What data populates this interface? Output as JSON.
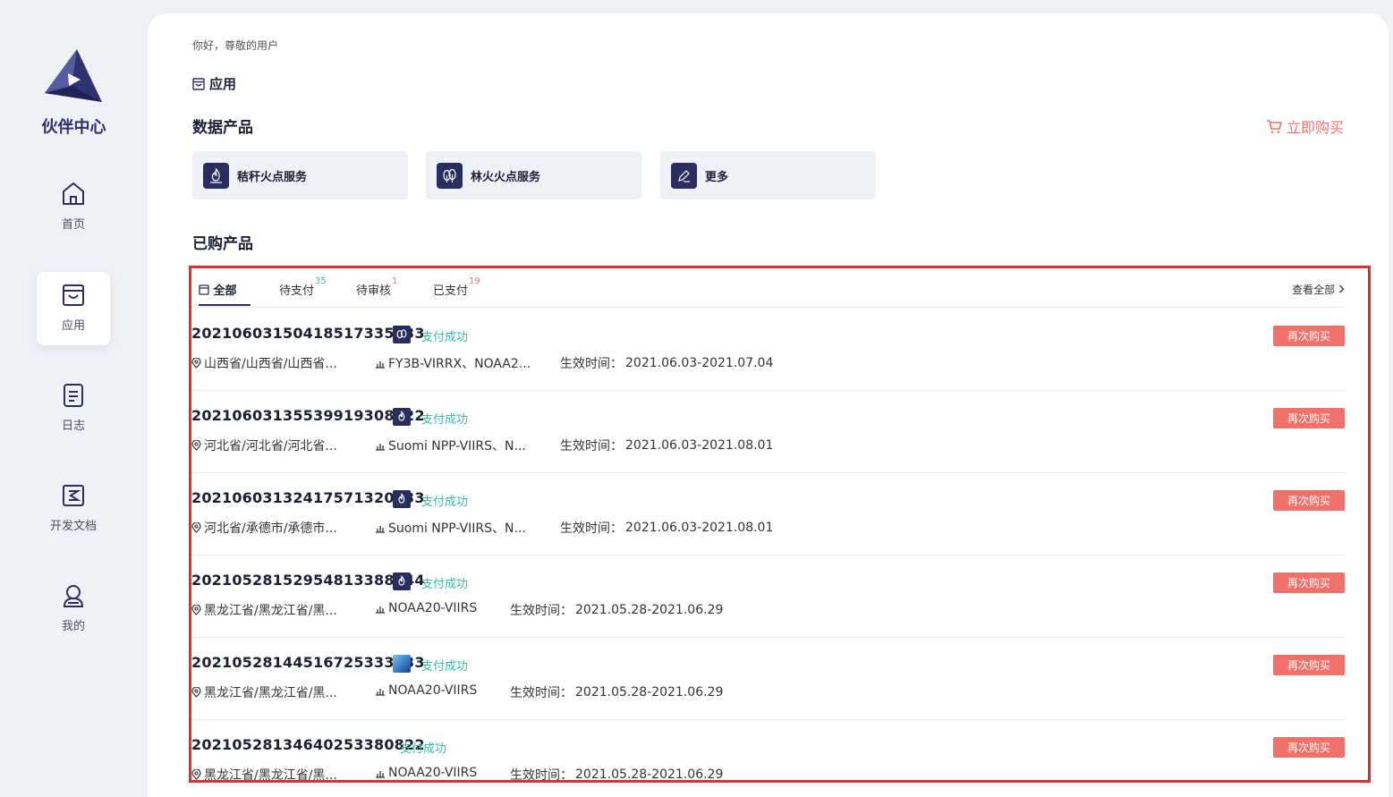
{
  "brand": {
    "name": "伙伴中心"
  },
  "nav": [
    {
      "label": "首页",
      "icon": "home-icon"
    },
    {
      "label": "应用",
      "icon": "app-icon",
      "active": true
    },
    {
      "label": "日志",
      "icon": "log-icon"
    },
    {
      "label": "开发文档",
      "icon": "docs-icon"
    },
    {
      "label": "我的",
      "icon": "user-icon"
    }
  ],
  "greeting": "你好，尊敬的用户",
  "app_title": "应用",
  "data_products": {
    "title": "数据产品",
    "buy_now": "立即购买",
    "items": [
      {
        "label": "秸秆火点服务",
        "icon": "fire-icon"
      },
      {
        "label": "林火火点服务",
        "icon": "forest-fire-icon"
      },
      {
        "label": "更多",
        "icon": "edit-icon"
      }
    ]
  },
  "purchased": {
    "title": "已购产品",
    "tabs": [
      {
        "label": "全部",
        "count": ""
      },
      {
        "label": "待支付",
        "count": "35"
      },
      {
        "label": "待审核",
        "count": "1"
      },
      {
        "label": "已支付",
        "count": "19"
      }
    ],
    "view_all": "查看全部",
    "rebuy_label": "再次购买",
    "time_prefix": "生效时间：",
    "orders": [
      {
        "id": "20210603150418517335833",
        "status": "支付成功",
        "icon": "forest-fire-icon",
        "region": "山西省/山西省/山西省...",
        "sensors": "FY3B-VIRRX、NOAA2...",
        "time": "2021.06.03-2021.07.04"
      },
      {
        "id": "20210603135539919308522",
        "status": "支付成功",
        "icon": "fire-icon",
        "region": "河北省/河北省/河北省...",
        "sensors": "Suomi NPP-VIIRS、N...",
        "time": "2021.06.03-2021.08.01"
      },
      {
        "id": "20210603132417571320833",
        "status": "支付成功",
        "icon": "fire-icon",
        "region": "河北省/承德市/承德市...",
        "sensors": "Suomi NPP-VIIRS、N...",
        "time": "2021.06.03-2021.08.01"
      },
      {
        "id": "20210528152954813388844",
        "status": "支付成功",
        "icon": "fire-icon",
        "region": "黑龙江省/黑龙江省/黑...",
        "sensors": "NOAA20-VIIRS",
        "time": "2021.05.28-2021.06.29"
      },
      {
        "id": "20210528144516725333833",
        "status": "支付成功",
        "icon": "satellite-image-icon",
        "region": "黑龙江省/黑龙江省/黑...",
        "sensors": "NOAA20-VIIRS",
        "time": "2021.05.28-2021.06.29"
      },
      {
        "id": "20210528134640253380822",
        "status": "支付成功",
        "icon": "",
        "region": "黑龙江省/黑龙江省/黑...",
        "sensors": "NOAA20-VIIRS",
        "time": "2021.05.28-2021.06.29"
      }
    ]
  }
}
